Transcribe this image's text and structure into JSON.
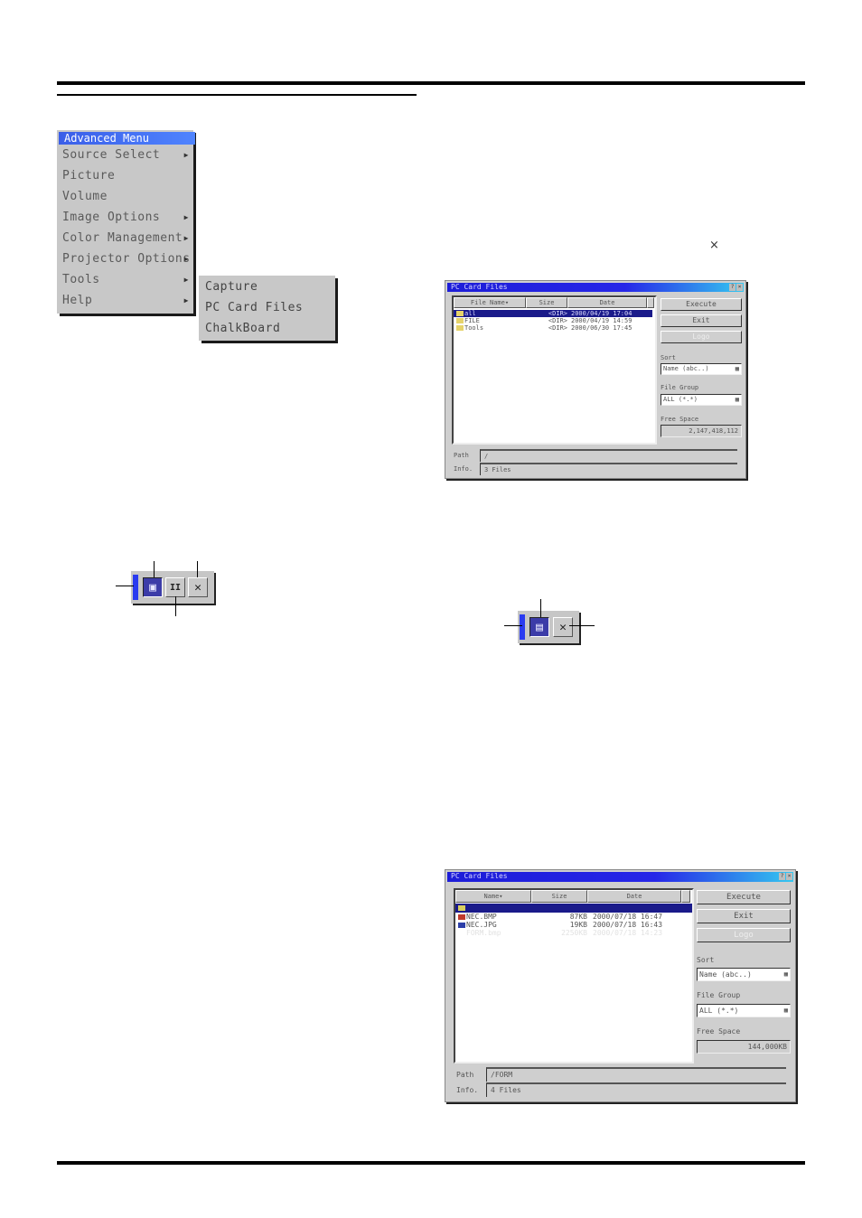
{
  "advanced_menu": {
    "title": "Advanced Menu",
    "items": [
      {
        "label": "Source Select",
        "has_submenu": true
      },
      {
        "label": "Picture",
        "has_submenu": false
      },
      {
        "label": "Volume",
        "has_submenu": false
      },
      {
        "label": "Image Options",
        "has_submenu": true
      },
      {
        "label": "Color Management",
        "has_submenu": true
      },
      {
        "label": "Projector Options",
        "has_submenu": true
      },
      {
        "label": "Tools",
        "has_submenu": true
      },
      {
        "label": "Help",
        "has_submenu": true
      }
    ],
    "arrow_glyph": "▶",
    "tools_submenu": [
      "Capture",
      "PC Card Files",
      "ChalkBoard"
    ]
  },
  "capture_toolbar": {
    "buttons": [
      {
        "icon": "capture-icon",
        "glyph": "▣"
      },
      {
        "icon": "pause-icon",
        "glyph": "II"
      },
      {
        "icon": "close-icon",
        "glyph": "✕"
      }
    ]
  },
  "close_symbol": "×",
  "pc_card_dialog_1": {
    "title": "PC Card Files",
    "title_buttons": [
      "?",
      "×"
    ],
    "columns": [
      "File Name▾",
      "Size",
      "Date"
    ],
    "rows": [
      {
        "name": "all",
        "size": "<DIR>",
        "date": "2000/04/19 17:04",
        "selected": true
      },
      {
        "name": "FILE",
        "size": "<DIR>",
        "date": "2000/04/19 14:59",
        "selected": false
      },
      {
        "name": "Tools",
        "size": "<DIR>",
        "date": "2000/06/30 17:45",
        "selected": false
      }
    ],
    "buttons": {
      "execute": "Execute",
      "exit": "Exit",
      "logo": "Logo"
    },
    "sort_label": "Sort",
    "sort_value": "Name (abc..)",
    "file_group_label": "File Group",
    "file_group_value": "ALL (*.*)",
    "free_space_label": "Free Space",
    "free_space_value": "2,147,418,112",
    "path_label": "Path",
    "path_value": "/",
    "info_label": "Info.",
    "info_value": "3 Files"
  },
  "save_toolbar": {
    "buttons": [
      {
        "icon": "save-icon",
        "glyph": "▤"
      },
      {
        "icon": "close-icon",
        "glyph": "✕"
      }
    ]
  },
  "pc_card_dialog_2": {
    "title": "PC Card Files",
    "title_buttons": [
      "?",
      "×"
    ],
    "columns": [
      "Name▾",
      "Size",
      "Date"
    ],
    "rows": [
      {
        "name": "",
        "size": "",
        "date": "",
        "selected": true,
        "icon_color": "#d8cf60"
      },
      {
        "name": "NEC.BMP",
        "size": "87KB",
        "date": "2000/07/18 16:47",
        "selected": false,
        "icon_color": "#c0392b"
      },
      {
        "name": "NEC.JPG",
        "size": "19KB",
        "date": "2000/07/18 16:43",
        "selected": false,
        "icon_color": "#2c3ea8"
      },
      {
        "name": "FORM.bmp",
        "size": "2250KB",
        "date": "2000/07/18 14:23",
        "selected": false,
        "faded": true,
        "icon_color": "#ffffff"
      }
    ],
    "buttons": {
      "execute": "Execute",
      "exit": "Exit",
      "logo": "Logo"
    },
    "sort_label": "Sort",
    "sort_value": "Name (abc..)",
    "file_group_label": "File Group",
    "file_group_value": "ALL (*.*)",
    "free_space_label": "Free Space",
    "free_space_value": "144,000KB",
    "path_label": "Path",
    "path_value": "/FORM",
    "info_label": "Info.",
    "info_value": "4 Files"
  }
}
